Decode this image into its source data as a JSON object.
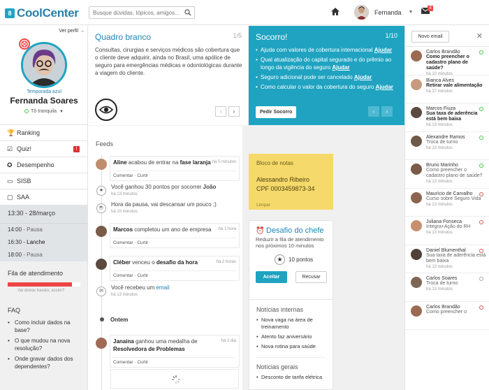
{
  "app": {
    "name": "CoolCenter",
    "logo_letter": "8"
  },
  "search": {
    "placeholder": "Busque dúvidas, tópicos, amigos..."
  },
  "topbar": {
    "user_name": "Fernanda",
    "mail_count": "8"
  },
  "profile": {
    "ver_perfil": "Ver perfil →",
    "temporada": "Temporada azul",
    "name": "Fernanda Soares",
    "status": "Tô tranquila"
  },
  "menu": [
    {
      "label": "Ranking",
      "icon": "trophy-icon"
    },
    {
      "label": "Quiz!",
      "icon": "quiz-icon",
      "alert": "!"
    },
    {
      "label": "Desempenho",
      "icon": "medal-icon"
    },
    {
      "label": "SISB",
      "icon": "monitor-icon"
    },
    {
      "label": "SAA",
      "icon": "chat-icon"
    }
  ],
  "schedule": {
    "header": "13:30 - 28/março",
    "rows": [
      {
        "time": "14:00",
        "label": "- Pausa",
        "current": false
      },
      {
        "time": "16:30",
        "label": "- Lanche",
        "current": true
      },
      {
        "time": "18:00",
        "label": "- Pausa",
        "current": false
      }
    ]
  },
  "fila": {
    "title": "Fila de atendimento",
    "sub": "Vai deixar barato, assim?",
    "level": 0.88
  },
  "faq": {
    "title": "FAQ",
    "items": [
      "Como incluir dados na base?",
      "O que mudou na nova resolução?",
      "Onde gravar dados dos dependentes?"
    ]
  },
  "card1": {
    "title": "Quadro branco",
    "count": "1/5",
    "body": "Consultas, cirurgias e serviços médicos são cobertura que o cliente deve adquirir, ainda no Brasil, uma apólice de seguro para emergências médicas e odontológicas durante a viagem do cliente."
  },
  "card2": {
    "title": "Socorro!",
    "count": "1/10",
    "items": [
      {
        "text": "Ajuda com valores de cobertura internacional",
        "link": "Ajudar"
      },
      {
        "text": "Qual atualização do capital segurado e do prêmio ao longo da vigência do seguro",
        "link": "Ajudar"
      },
      {
        "text": "Seguro adicional pode ser cancelado",
        "link": "Ajudar"
      },
      {
        "text": "Como calcular o valor da cobertura do seguro",
        "link": "Ajudar"
      }
    ],
    "button": "Pedir Socorro"
  },
  "feeds": {
    "title": "Feeds",
    "items": [
      {
        "name": "Aline",
        "text": " acabou de entrar na ",
        "bold": "fase laranja",
        "time": "há 5 minutos",
        "comment": "Comentar",
        "like": "Curtir"
      },
      {
        "text": "Você ganhou 30 pontos por socorrer ",
        "bold": "João",
        "time": "há 13 minutos"
      },
      {
        "text": "Hora da pausa, vai descansar um pouco  ;)",
        "time": "há 10 minutos"
      },
      {
        "name": "Marcos",
        "text": " completou um ano de empresa",
        "time": "há 1 hora",
        "comment": "Comentar",
        "like": "Curtir"
      },
      {
        "name": "Cléber",
        "text": " venceu o ",
        "bold": "desafio da hora",
        "time": "há 2 horas",
        "comment": "Comentar",
        "like": "Curtir"
      },
      {
        "text": "Você recebeu um ",
        "link": "email",
        "time": "há 13 minutos"
      },
      {
        "name": "Janaina",
        "text": " ganhou uma medalha de ",
        "bold": "Resolvedora de Problemas",
        "time": "há 1 dia",
        "comment": "Comentar",
        "like": "Curtir"
      }
    ],
    "ontem": "Ontem"
  },
  "notes": {
    "title": "Bloco de notas",
    "line1": "Alessandro Ribeiro",
    "line2": "CPF 0003459873-34",
    "clear": "Limpar"
  },
  "desafio": {
    "title": "Desafio do chefe",
    "desc": "Reduzir a fila de atendimento nos próximos 10 minutos",
    "points": "10 pontos",
    "accept": "Aceitar",
    "decline": "Recusar"
  },
  "news": {
    "title1": "Notícias internas",
    "items1": [
      "Nova vaga na área de treinamento",
      "Atento faz aniversário",
      "Nova rotina para saúde"
    ],
    "title2": "Notícias gerais",
    "items2": [
      "Desconto de tarifa elétrica"
    ]
  },
  "messages": {
    "new_button": "Novo email",
    "items": [
      {
        "name": "Carlos Brandão",
        "subject": "Como preencher o cadastro plano de saúde?",
        "time": "há 10 minutos",
        "status": "online",
        "unread": true
      },
      {
        "name": "Bianca Alves",
        "subject": "Retirar vale alimentação",
        "time": "há 37 minutos",
        "status": "none",
        "unread": true
      },
      {
        "name": "Marcos Fiuza",
        "subject": "Sua taxa de aderência está bem baixa",
        "time": "há 13 minutos",
        "status": "online",
        "unread": true
      },
      {
        "name": "Alexandre Ramos",
        "subject": "Troca de turno",
        "time": "há 13 minutos",
        "status": "online",
        "unread": false
      },
      {
        "name": "Bruno Marinho",
        "subject": "Como preencher o cadastro plano de saúde?",
        "time": "há 13 minutos",
        "status": "online",
        "unread": false
      },
      {
        "name": "Maurício de Carvalho",
        "subject": "Curso sobre Seguro Vida",
        "time": "há 13 minutos",
        "status": "offline",
        "unread": false
      },
      {
        "name": "Juliana Fonseca",
        "subject": "Integra+Ação do RH",
        "time": "há 13 minutos",
        "status": "offline",
        "unread": false
      },
      {
        "name": "Daniel Blumenthal",
        "subject": "Sua taxa de aderência está bem baixa",
        "time": "há 13 minutos",
        "status": "offline",
        "unread": false
      },
      {
        "name": "Carlos Soares",
        "subject": "Troca de turno",
        "time": "há 13 minutos",
        "status": "away",
        "unread": false
      },
      {
        "name": "Carlos Brandão",
        "subject": "Como preencher o",
        "time": "",
        "status": "offline",
        "unread": false
      }
    ]
  },
  "colors": {
    "accent": "#1fa3c1",
    "brand": "#2a7fa8",
    "alert": "#e44",
    "notes": "#f5d96a"
  }
}
